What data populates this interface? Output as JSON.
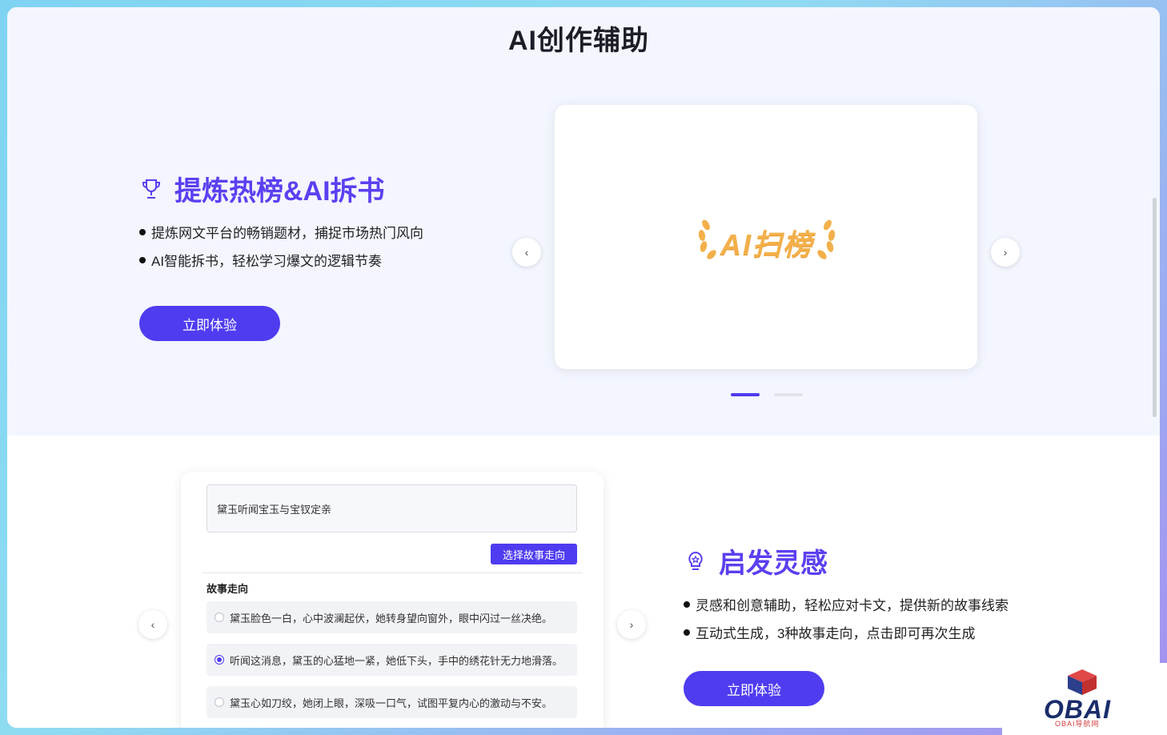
{
  "page": {
    "title": "AI创作辅助"
  },
  "feature1": {
    "heading": "提炼热榜&AI拆书",
    "icon": "trophy-icon",
    "bullets": [
      "提炼网文平台的畅销题材，捕捉市场热门风向",
      "AI智能拆书，轻松学习爆文的逻辑节奏"
    ],
    "cta_label": "立即体验",
    "carousel": {
      "logo_text": "AI扫榜",
      "prev_icon": "chevron-left-icon",
      "next_icon": "chevron-right-icon",
      "active_index": 0,
      "slide_count": 2
    }
  },
  "feature2": {
    "heading": "启发灵感",
    "icon": "lightbulb-icon",
    "bullets": [
      "灵感和创意辅助，轻松应对卡文，提供新的故事线索",
      "互动式生成，3种故事走向，点击即可再次生成"
    ],
    "cta_label": "立即体验",
    "demo": {
      "input_value": "黛玉听闻宝玉与宝钗定亲",
      "select_button": "选择故事走向",
      "section_label": "故事走向",
      "options": [
        {
          "text": "黛玉脸色一白，心中波澜起伏，她转身望向窗外，眼中闪过一丝决绝。",
          "selected": false
        },
        {
          "text": "听闻这消息，黛玉的心猛地一紧，她低下头，手中的绣花针无力地滑落。",
          "selected": true
        },
        {
          "text": "黛玉心如刀绞，她闭上眼，深吸一口气，试图平复内心的激动与不安。",
          "selected": false
        }
      ]
    }
  },
  "watermark": {
    "text": "OBAI",
    "sub": "OBAI导航网"
  },
  "colors": {
    "accent": "#4f3cf0",
    "heading": "#5a40f0",
    "logo_gold": "#f3b04a"
  }
}
